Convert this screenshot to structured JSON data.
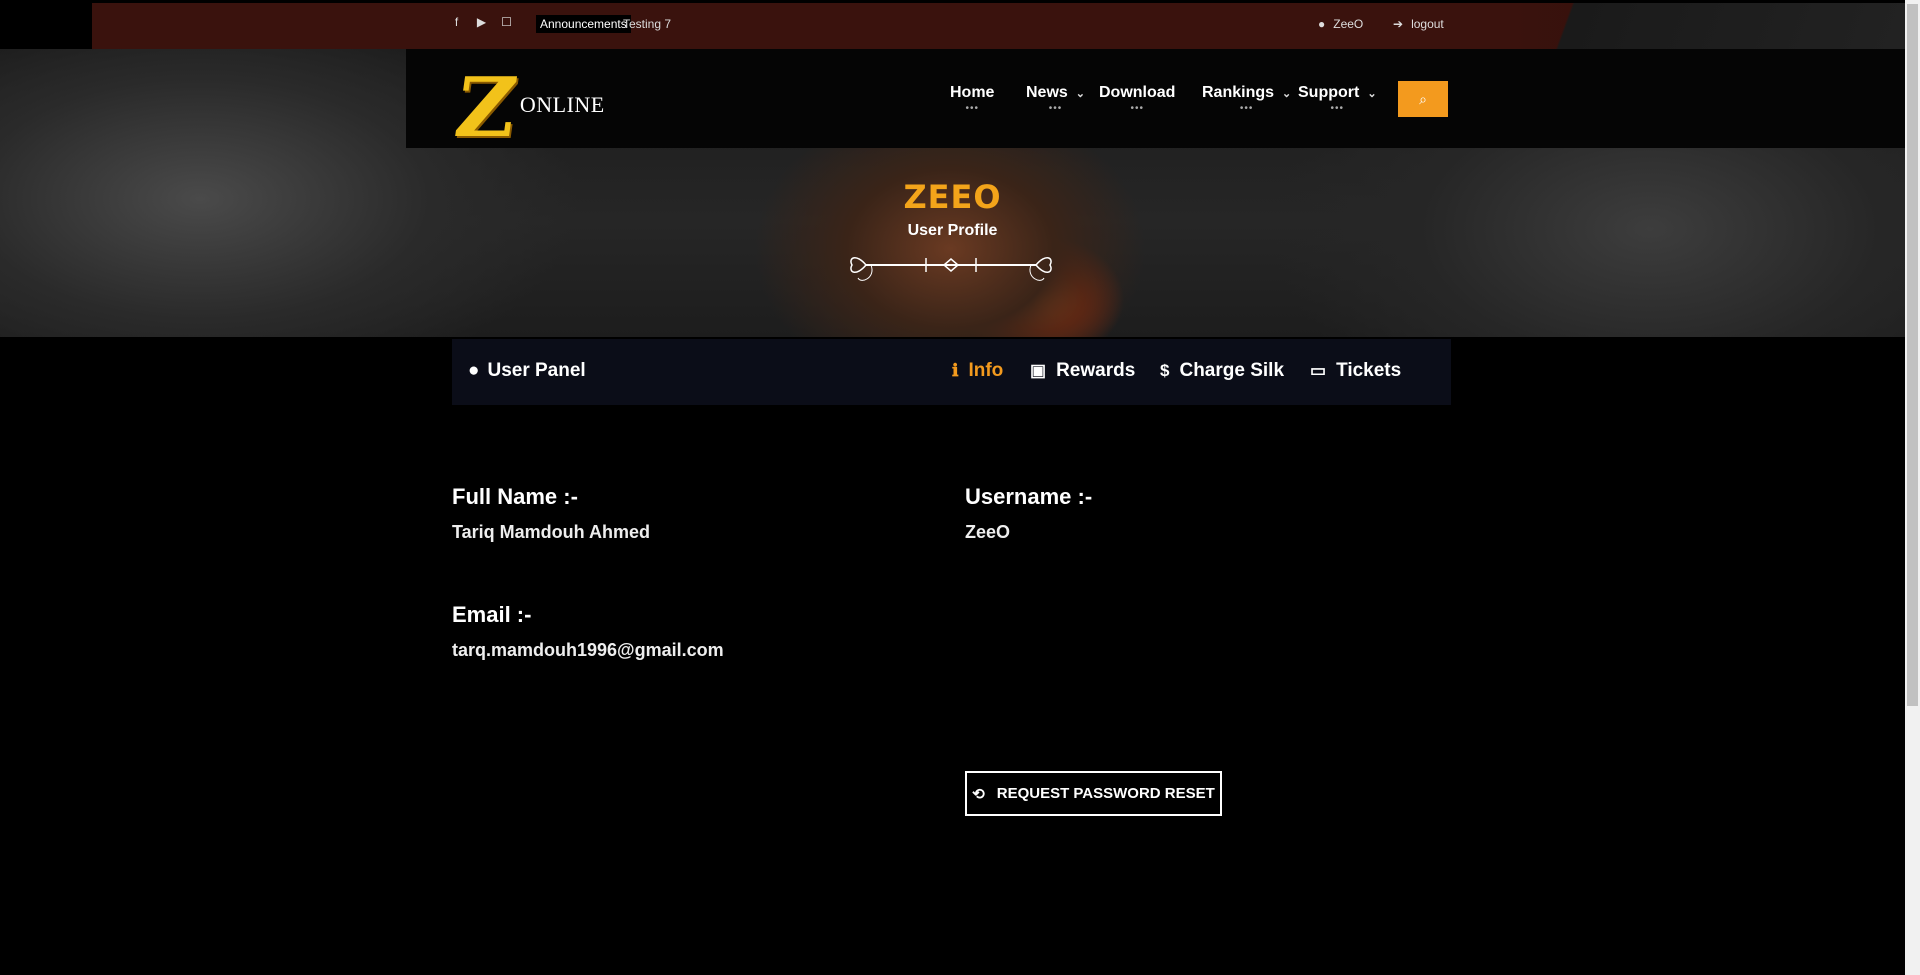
{
  "topbar": {
    "social": [
      "facebook-icon",
      "youtube-icon",
      "discord-icon"
    ],
    "announcement_tag": "Announcements",
    "announcement_text": "Testing 7",
    "user": "ZeeO",
    "logout": "logout"
  },
  "logo": {
    "letter": "Z",
    "text": "ONLINE"
  },
  "nav": {
    "home": "Home",
    "news": "News",
    "download": "Download",
    "rankings": "Rankings",
    "support": "Support",
    "dots": "•••"
  },
  "header": {
    "brand": "ZEEO",
    "subtitle": "User Profile"
  },
  "panel": {
    "title": "User Panel",
    "tabs": [
      {
        "label": "Info"
      },
      {
        "label": "Rewards"
      },
      {
        "label": "Charge Silk"
      },
      {
        "label": "Tickets"
      }
    ]
  },
  "profile": {
    "full_name_label": "Full Name :-",
    "full_name": "Tariq Mamdouh Ahmed",
    "username_label": "Username :-",
    "username": "ZeeO",
    "email_label": "Email :-",
    "email": "tarq.mamdouh1996@gmail.com"
  },
  "actions": {
    "reset_label": "REQUEST PASSWORD RESET"
  },
  "colors": {
    "accent": "#f39a1e",
    "topbar": "#3a120d",
    "panel": "#0b0d18"
  }
}
